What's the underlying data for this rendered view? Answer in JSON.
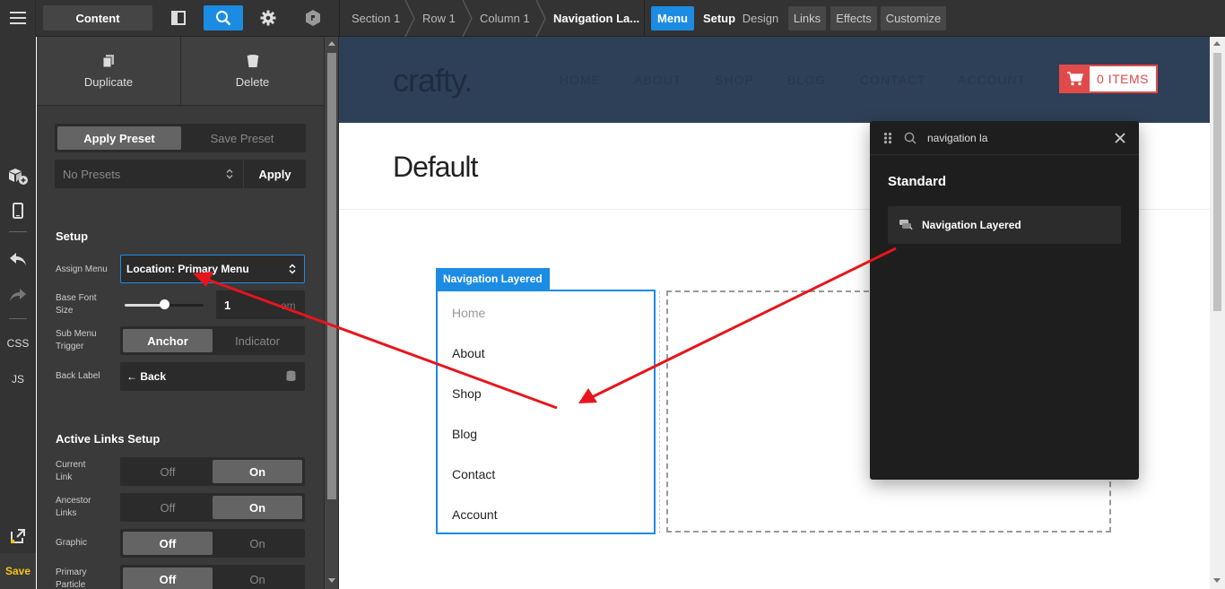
{
  "rail": {
    "css_label": "CSS",
    "js_label": "JS",
    "save_label": "Save",
    "icons": [
      "menu-icon",
      "add-element-icon",
      "responsive-icon",
      "undo-icon",
      "redo-icon",
      "external-link-icon"
    ]
  },
  "topbar": {
    "content_label": "Content",
    "breadcrumbs": [
      "Section 1",
      "Row 1",
      "Column 1",
      "Navigation La..."
    ],
    "tabs": [
      {
        "label": "Menu",
        "active": true
      },
      {
        "label": "Setup"
      },
      {
        "label": "Design"
      },
      {
        "label": "Links"
      },
      {
        "label": "Effects"
      },
      {
        "label": "Customize"
      }
    ]
  },
  "panel": {
    "duplicate_label": "Duplicate",
    "delete_label": "Delete",
    "apply_preset_label": "Apply Preset",
    "save_preset_label": "Save Preset",
    "presets_value": "No Presets",
    "apply_label": "Apply",
    "setup_heading": "Setup",
    "assign_menu_label": "Assign Menu",
    "assign_menu_value": "Location: Primary Menu",
    "base_font_label_1": "Base Font",
    "base_font_label_2": "Size",
    "base_font_value": "1",
    "base_font_unit": "em",
    "base_font_slider_fraction": 0.5,
    "submenu_label_1": "Sub Menu",
    "submenu_label_2": "Trigger",
    "submenu_opt_anchor": "Anchor",
    "submenu_opt_indicator": "Indicator",
    "back_label_label": "Back Label",
    "back_label_value": "← Back",
    "active_heading": "Active Links Setup",
    "current_label_1": "Current",
    "current_label_2": "Link",
    "ancestor_label_1": "Ancestor",
    "ancestor_label_2": "Links",
    "graphic_label": "Graphic",
    "primary_label_1": "Primary",
    "primary_label_2": "Particle",
    "off_label": "Off",
    "on_label": "On"
  },
  "site": {
    "logo": "crafty.",
    "nav": [
      "HOME",
      "ABOUT",
      "SHOP",
      "BLOG",
      "CONTACT",
      "ACCOUNT"
    ],
    "cart_label": "0 ITEMS",
    "page_title": "Default"
  },
  "nav_element": {
    "tag": "Navigation Layered",
    "items": [
      "Home",
      "About",
      "Shop",
      "Blog",
      "Contact",
      "Account"
    ]
  },
  "popup": {
    "query": "navigation la",
    "heading": "Standard",
    "result_label": "Navigation Layered"
  },
  "colors": {
    "accent": "#1c8ce3",
    "header_bg": "#2e4057",
    "cart_red": "#e14a4a",
    "annotation_red": "#e8141b",
    "panel_bg": "#3a3a3a"
  }
}
